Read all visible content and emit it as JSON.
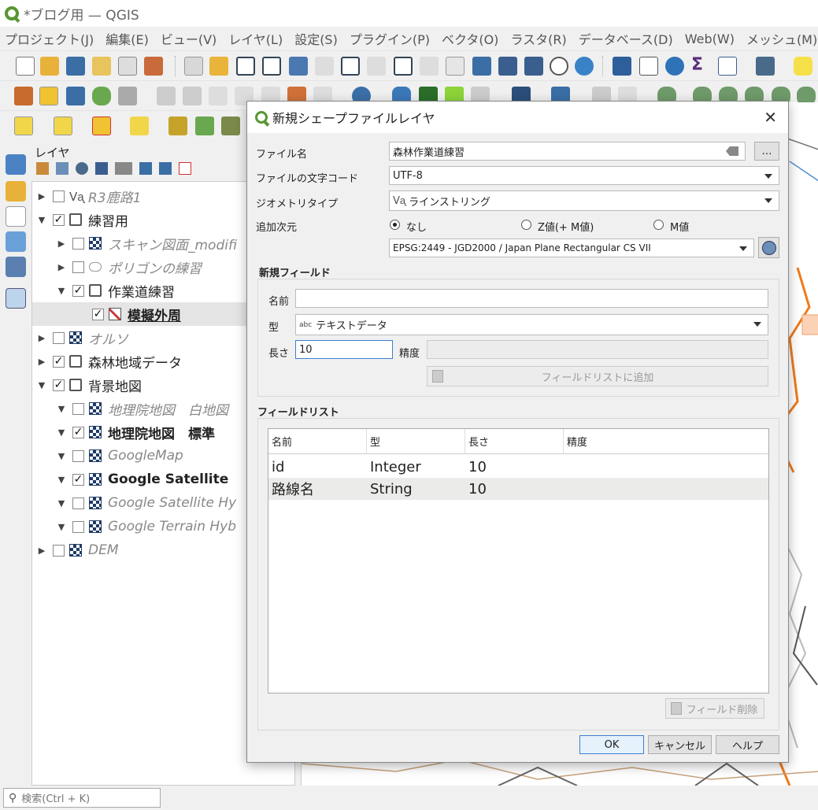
{
  "window": {
    "title": "*ブログ用 — QGIS"
  },
  "menubar": [
    "プロジェクト(J)",
    "編集(E)",
    "ビュー(V)",
    "レイヤ(L)",
    "設定(S)",
    "プラグイン(P)",
    "ベクタ(O)",
    "ラスタ(R)",
    "データベース(D)",
    "Web(W)",
    "メッシュ(M)"
  ],
  "layers_panel": {
    "title": "レイヤ",
    "items": [
      {
        "label": "R3鹿路1",
        "checked": false,
        "icon": "line-layer-icon"
      },
      {
        "label": "練習用",
        "checked": true,
        "icon": "group-icon"
      },
      {
        "label": "スキャン図面_modifi",
        "checked": false,
        "icon": "raster-icon"
      },
      {
        "label": "ポリゴンの練習",
        "checked": false,
        "icon": "polygon-layer-icon"
      },
      {
        "label": "作業道練習",
        "checked": true,
        "icon": "group-icon"
      },
      {
        "label": "模擬外周",
        "checked": true,
        "icon": "edit-layer-icon"
      },
      {
        "label": "オルソ",
        "checked": false,
        "icon": "raster-icon"
      },
      {
        "label": "森林地域データ",
        "checked": true,
        "icon": "group-icon"
      },
      {
        "label": "背景地図",
        "checked": true,
        "icon": "group-icon"
      },
      {
        "label": "地理院地図　白地図",
        "checked": false,
        "icon": "raster-icon"
      },
      {
        "label": "地理院地図　標準",
        "checked": true,
        "icon": "raster-icon"
      },
      {
        "label": "GoogleMap",
        "checked": false,
        "icon": "raster-icon"
      },
      {
        "label": "Google Satellite",
        "checked": true,
        "icon": "raster-icon"
      },
      {
        "label": "Google Satellite Hy",
        "checked": false,
        "icon": "raster-icon"
      },
      {
        "label": "Google Terrain Hyb",
        "checked": false,
        "icon": "raster-icon"
      },
      {
        "label": "DEM",
        "checked": false,
        "icon": "raster-icon"
      }
    ]
  },
  "search": {
    "placeholder": "検索(Ctrl + K)"
  },
  "dialog": {
    "title": "新規シェープファイルレイヤ",
    "file_name_label": "ファイル名",
    "file_name_value": "森林作業道練習",
    "browse_label": "…",
    "encoding_label": "ファイルの文字コード",
    "encoding_value": "UTF-8",
    "geometry_label": "ジオメトリタイプ",
    "geometry_value": "ラインストリング",
    "dimensions_label": "追加次元",
    "dim_options": [
      "なし",
      "Z値(+ M値)",
      "M値"
    ],
    "dim_selected": "なし",
    "crs_value": "EPSG:2449 - JGD2000 / Japan Plane Rectangular CS VII",
    "new_field": {
      "title": "新規フィールド",
      "name_label": "名前",
      "name_value": "",
      "type_label": "型",
      "type_prefix": "abc",
      "type_value": "テキストデータ",
      "length_label": "長さ",
      "length_value": "10",
      "precision_label": "精度",
      "precision_value": "",
      "add_button": "フィールドリストに追加"
    },
    "field_list": {
      "title": "フィールドリスト",
      "columns": [
        "名前",
        "型",
        "長さ",
        "精度"
      ],
      "rows": [
        {
          "name": "id",
          "type": "Integer",
          "length": "10",
          "precision": ""
        },
        {
          "name": "路線名",
          "type": "String",
          "length": "10",
          "precision": ""
        }
      ],
      "delete_button": "フィールド削除"
    },
    "ok_button": "OK",
    "cancel_button": "キャンセル",
    "help_button": "ヘルプ"
  }
}
